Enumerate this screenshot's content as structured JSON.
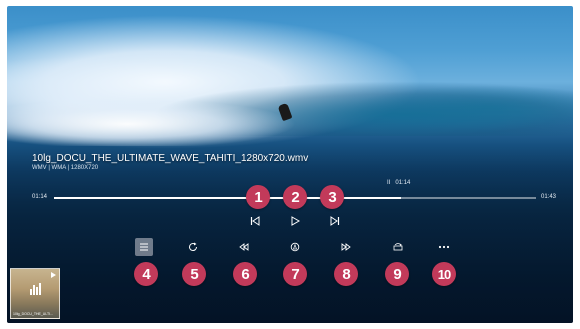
{
  "player": {
    "file_title": "10lg_DOCU_THE_ULTIMATE_WAVE_TAHITI_1280x720.wmv",
    "file_info": "WMV | WMA | 1280X720",
    "status_pause_symbol": "II",
    "status_time": "01:14",
    "current_time": "01:14",
    "total_time": "01:43",
    "progress_fraction": 0.72
  },
  "callouts": [
    "1",
    "2",
    "3",
    "4",
    "5",
    "6",
    "7",
    "8",
    "9",
    "10"
  ],
  "icons": {
    "previous": "skip-previous-icon",
    "play": "play-icon",
    "next": "skip-next-icon",
    "playlist": "playlist-icon",
    "repeat": "repeat-icon",
    "rewind": "rewind-icon",
    "ab_repeat": "ab-repeat-icon",
    "fast_forward": "fast-forward-icon",
    "rotate": "rotate-icon",
    "more": "more-icon"
  },
  "thumbnail": {
    "caption": "10lg_DOCU_THE_ULTI..."
  },
  "colors": {
    "callout": "#c23a5a",
    "progress": "#ffffff"
  }
}
